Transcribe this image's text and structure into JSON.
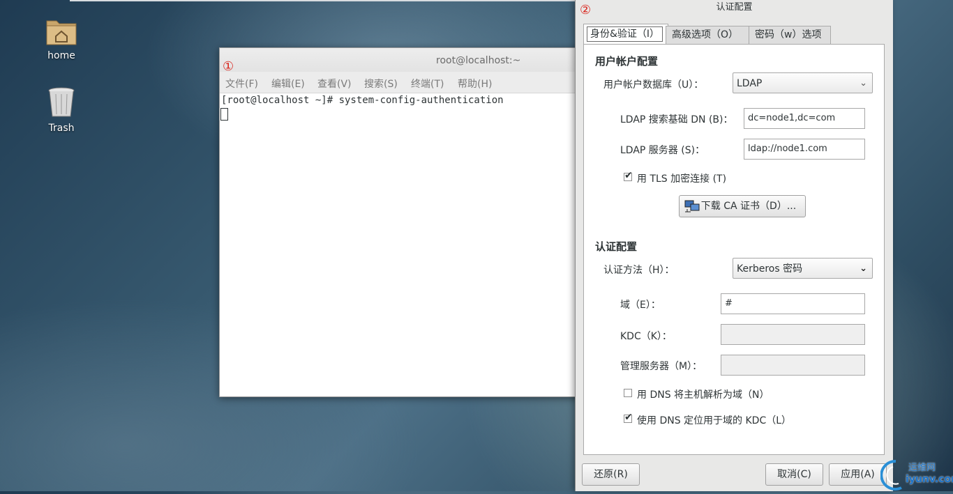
{
  "desktop": {
    "icons": [
      {
        "label": "home"
      },
      {
        "label": "Trash"
      }
    ]
  },
  "terminal": {
    "marker": "①",
    "title": "root@localhost:~",
    "menu": [
      "文件(F)",
      "编辑(E)",
      "查看(V)",
      "搜索(S)",
      "终端(T)",
      "帮助(H)"
    ],
    "line": "[root@localhost ~]# system-config-authentication"
  },
  "dialog": {
    "marker": "②",
    "title": "认证配置",
    "tabs": [
      "身份&验证（I）",
      "高级选项（O）",
      "密码（w）选项"
    ],
    "user_section": {
      "heading": "用户帐户配置",
      "db_label": "用户帐户数据库（U）：",
      "db_value": "LDAP",
      "basedn_label": "LDAP 搜索基础 DN (B)：",
      "basedn_value": "dc=node1,dc=com",
      "server_label": "LDAP 服务器 (S)：",
      "server_value": "ldap://node1.com",
      "tls_label": "用 TLS 加密连接 (T)",
      "tls_checked": true,
      "download_ca_label": "下载 CA 证书（D）..."
    },
    "auth_section": {
      "heading": "认证配置",
      "method_label": "认证方法（H）：",
      "method_value": "Kerberos 密码",
      "realm_label": "域（E）：",
      "realm_value": "#",
      "kdc_label": "KDC（K）：",
      "kdc_value": "",
      "admin_label": "管理服务器（M）：",
      "admin_value": "",
      "dns_host_label": "用 DNS 将主机解析为域（N）",
      "dns_host_checked": false,
      "dns_kdc_label": "使用 DNS 定位用于域的 KDC（L）",
      "dns_kdc_checked": true
    },
    "buttons": {
      "revert": "还原(R)",
      "cancel": "取消(C)",
      "apply": "应用(A)"
    }
  },
  "watermark": {
    "top": "运维网",
    "bottom": "iyunv.com"
  }
}
